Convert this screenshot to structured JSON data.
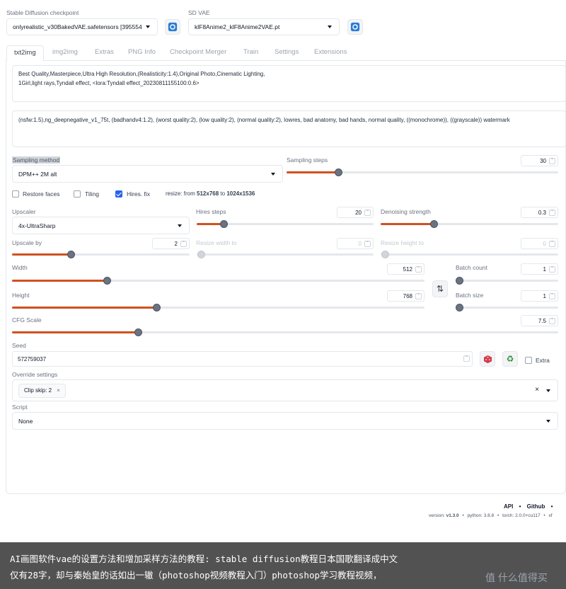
{
  "top": {
    "checkpoint_label": "Stable Diffusion checkpoint",
    "checkpoint_value": "onlyrealistic_v30BakedVAE.safetensors [395554",
    "vae_label": "SD VAE",
    "vae_value": "klF8Anime2_klF8Anime2VAE.pt"
  },
  "tabs": [
    "txt2img",
    "img2img",
    "Extras",
    "PNG Info",
    "Checkpoint Merger",
    "Train",
    "Settings",
    "Extensions"
  ],
  "prompt": {
    "positive_line1": "Best Quality,Masterpiece,Ultra High Resolution,(Realisticity:1.4),Original Photo,Cinematic Lighting,",
    "positive_line2": "1Girl,light rays,Tyndall effect, <lora:Tyndall effect_20230811155100:0.6>",
    "negative": "(nsfw:1.5),ng_deepnegative_v1_75t, (badhandv4:1.2), (worst quality:2), (low quality:2), (normal quality:2), lowres, bad anatomy, bad hands, normal quality, ((monochrome)), ((grayscale)) watermark"
  },
  "sampling": {
    "method_label": "Sampling method",
    "method_value": "DPM++ 2M alt",
    "steps_label": "Sampling steps",
    "steps_value": "30",
    "steps_fraction": 0.19
  },
  "options": {
    "restore_faces": "Restore faces",
    "tiling": "Tiling",
    "hires_fix": "Hires. fix",
    "resize_prefix": "resize: from",
    "resize_from": "512x768",
    "resize_to_word": "to",
    "resize_to": "1024x1536"
  },
  "hires": {
    "upscaler_label": "Upscaler",
    "upscaler_value": "4x-UltraSharp",
    "hires_steps_label": "Hires steps",
    "hires_steps_value": "20",
    "hires_steps_fraction": 0.15,
    "denoise_label": "Denoising strength",
    "denoise_value": "0.3",
    "denoise_fraction": 0.3,
    "upscale_by_label": "Upscale by",
    "upscale_by_value": "2",
    "upscale_by_fraction": 0.33,
    "resize_width_label": "Resize width to",
    "resize_width_value": "0",
    "resize_height_label": "Resize height to",
    "resize_height_value": "0"
  },
  "size": {
    "width_label": "Width",
    "width_value": "512",
    "width_fraction": 0.23,
    "height_label": "Height",
    "height_value": "768",
    "height_fraction": 0.35,
    "batch_count_label": "Batch count",
    "batch_count_value": "1",
    "batch_size_label": "Batch size",
    "batch_size_value": "1",
    "swap_icon": "swap-arrows-icon"
  },
  "cfg": {
    "label": "CFG Scale",
    "value": "7.5",
    "fraction": 0.23
  },
  "seed": {
    "label": "Seed",
    "value": "572759037",
    "extra_label": "Extra"
  },
  "override": {
    "label": "Override settings",
    "chip": "Clip skip: 2"
  },
  "script": {
    "label": "Script",
    "value": "None"
  },
  "footer": {
    "api": "API",
    "github": "Github",
    "version_prefix": "version:",
    "version": "v1.3.0",
    "python": "python: 3.8.8",
    "torch": "torch: 2.0.0+cu117",
    "xf": "xf"
  },
  "banner": {
    "line1": "AI画图软件vae的设置方法和增加采样方法的教程: stable diffusion教程日本国歌翻译成中文",
    "line2": "仅有28字，却与秦始皇的话如出一辙（photoshop视频教程入门）photoshop学习教程视频，",
    "watermark": "值 什么值得买"
  },
  "colors": {
    "accent": "#d1501f",
    "checked": "#2563eb"
  }
}
